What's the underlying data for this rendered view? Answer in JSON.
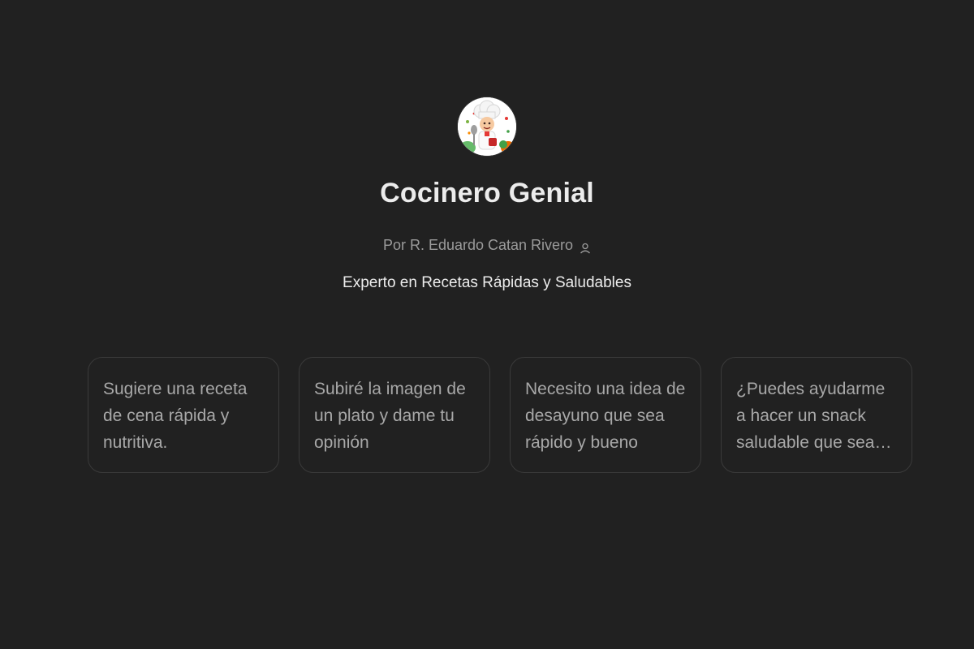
{
  "gpt": {
    "name": "Cocinero Genial",
    "byline": "Por R. Eduardo Catan Rivero",
    "description": "Experto en Recetas Rápidas y Saludables"
  },
  "icons": {
    "avatar": "chef-avatar-icon",
    "author": "person-icon"
  },
  "suggestions": [
    {
      "text": "Sugiere una receta de cena rápida y nutritiva."
    },
    {
      "text": "Subiré la imagen de un plato y dame tu opinión"
    },
    {
      "text": "Necesito una idea de desayuno que sea rápido y bueno"
    },
    {
      "text": "¿Puedes ayudarme a hacer un snack saludable que sea fácil"
    }
  ],
  "colors": {
    "background": "#212121",
    "card_border": "#3a3a3a",
    "title": "#ececec",
    "muted": "#9b9b9b"
  }
}
